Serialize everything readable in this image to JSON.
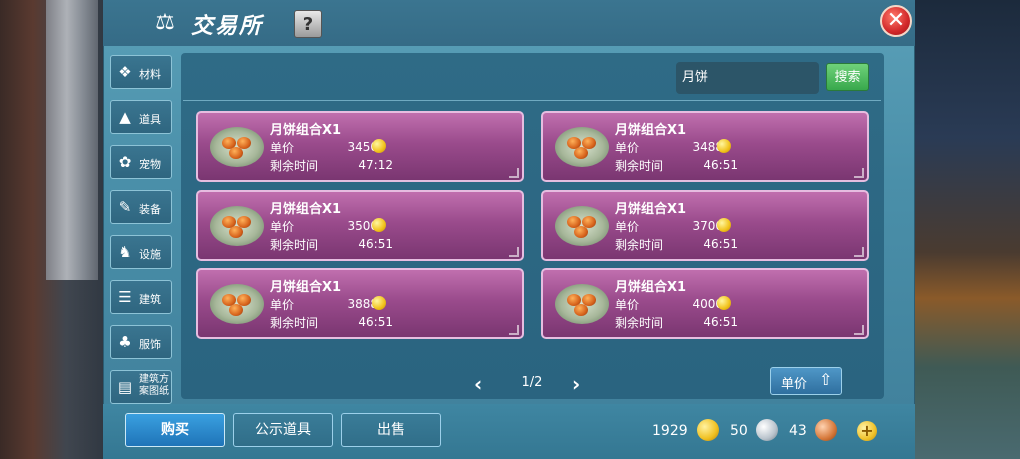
{
  "header": {
    "title": "交易所",
    "help_label": "?",
    "title_icon": "scales-icon",
    "close_icon": "close-icon"
  },
  "sidebar": {
    "items": [
      {
        "label": "材料",
        "icon": "material-icon"
      },
      {
        "label": "道具",
        "icon": "potion-icon"
      },
      {
        "label": "宠物",
        "icon": "paw-icon"
      },
      {
        "label": "装备",
        "icon": "equipment-icon"
      },
      {
        "label": "设施",
        "icon": "facility-icon"
      },
      {
        "label": "建筑",
        "icon": "building-icon"
      },
      {
        "label": "服饰",
        "icon": "clothing-icon"
      },
      {
        "label": "建筑方案图纸",
        "icon": "blueprint-icon"
      }
    ]
  },
  "search": {
    "value": "月饼",
    "button_label": "搜索"
  },
  "listings": [
    {
      "name": "月饼组合X1",
      "price_label": "单价",
      "price": "3450",
      "time_label": "剩余时间",
      "time": "47:12"
    },
    {
      "name": "月饼组合X1",
      "price_label": "单价",
      "price": "3488",
      "time_label": "剩余时间",
      "time": "46:51"
    },
    {
      "name": "月饼组合X1",
      "price_label": "单价",
      "price": "3500",
      "time_label": "剩余时间",
      "time": "46:51"
    },
    {
      "name": "月饼组合X1",
      "price_label": "单价",
      "price": "3700",
      "time_label": "剩余时间",
      "time": "46:51"
    },
    {
      "name": "月饼组合X1",
      "price_label": "单价",
      "price": "3888",
      "time_label": "剩余时间",
      "time": "46:51"
    },
    {
      "name": "月饼组合X1",
      "price_label": "单价",
      "price": "4000",
      "time_label": "剩余时间",
      "time": "46:51"
    }
  ],
  "pager": {
    "text": "1/2",
    "prev_symbol": "‹",
    "next_symbol": "›"
  },
  "sort": {
    "label": "单价",
    "icon": "sort-icon"
  },
  "bottom_tabs": [
    {
      "label": "购买",
      "active": true
    },
    {
      "label": "公示道具",
      "active": false
    },
    {
      "label": "出售",
      "active": false
    }
  ],
  "currency": {
    "gold": "1929",
    "silver": "50",
    "copper": "43",
    "add_symbol": "+"
  },
  "colors": {
    "panel": "#4a8fa9",
    "card": "#9a4b8c",
    "search_button": "#38a84c",
    "active_tab": "#1f74b8",
    "close": "#d2282a"
  }
}
